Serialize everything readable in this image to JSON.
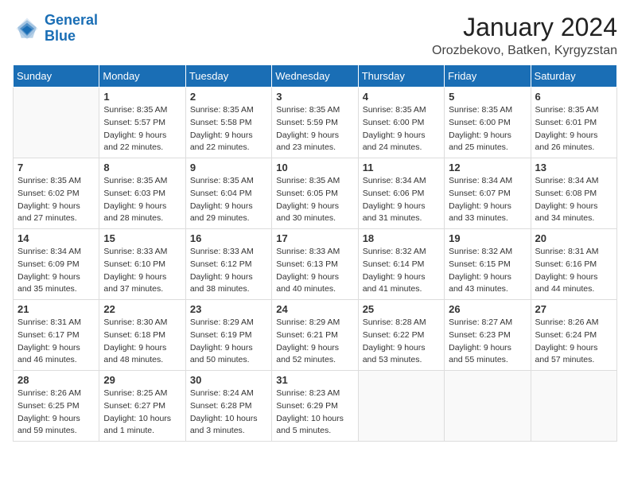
{
  "logo": {
    "line1": "General",
    "line2": "Blue"
  },
  "title": "January 2024",
  "location": "Orozbekovo, Batken, Kyrgyzstan",
  "weekdays": [
    "Sunday",
    "Monday",
    "Tuesday",
    "Wednesday",
    "Thursday",
    "Friday",
    "Saturday"
  ],
  "weeks": [
    [
      {
        "day": "",
        "sunrise": "",
        "sunset": "",
        "daylight": ""
      },
      {
        "day": "1",
        "sunrise": "Sunrise: 8:35 AM",
        "sunset": "Sunset: 5:57 PM",
        "daylight": "Daylight: 9 hours and 22 minutes."
      },
      {
        "day": "2",
        "sunrise": "Sunrise: 8:35 AM",
        "sunset": "Sunset: 5:58 PM",
        "daylight": "Daylight: 9 hours and 22 minutes."
      },
      {
        "day": "3",
        "sunrise": "Sunrise: 8:35 AM",
        "sunset": "Sunset: 5:59 PM",
        "daylight": "Daylight: 9 hours and 23 minutes."
      },
      {
        "day": "4",
        "sunrise": "Sunrise: 8:35 AM",
        "sunset": "Sunset: 6:00 PM",
        "daylight": "Daylight: 9 hours and 24 minutes."
      },
      {
        "day": "5",
        "sunrise": "Sunrise: 8:35 AM",
        "sunset": "Sunset: 6:00 PM",
        "daylight": "Daylight: 9 hours and 25 minutes."
      },
      {
        "day": "6",
        "sunrise": "Sunrise: 8:35 AM",
        "sunset": "Sunset: 6:01 PM",
        "daylight": "Daylight: 9 hours and 26 minutes."
      }
    ],
    [
      {
        "day": "7",
        "sunrise": "Sunrise: 8:35 AM",
        "sunset": "Sunset: 6:02 PM",
        "daylight": "Daylight: 9 hours and 27 minutes."
      },
      {
        "day": "8",
        "sunrise": "Sunrise: 8:35 AM",
        "sunset": "Sunset: 6:03 PM",
        "daylight": "Daylight: 9 hours and 28 minutes."
      },
      {
        "day": "9",
        "sunrise": "Sunrise: 8:35 AM",
        "sunset": "Sunset: 6:04 PM",
        "daylight": "Daylight: 9 hours and 29 minutes."
      },
      {
        "day": "10",
        "sunrise": "Sunrise: 8:35 AM",
        "sunset": "Sunset: 6:05 PM",
        "daylight": "Daylight: 9 hours and 30 minutes."
      },
      {
        "day": "11",
        "sunrise": "Sunrise: 8:34 AM",
        "sunset": "Sunset: 6:06 PM",
        "daylight": "Daylight: 9 hours and 31 minutes."
      },
      {
        "day": "12",
        "sunrise": "Sunrise: 8:34 AM",
        "sunset": "Sunset: 6:07 PM",
        "daylight": "Daylight: 9 hours and 33 minutes."
      },
      {
        "day": "13",
        "sunrise": "Sunrise: 8:34 AM",
        "sunset": "Sunset: 6:08 PM",
        "daylight": "Daylight: 9 hours and 34 minutes."
      }
    ],
    [
      {
        "day": "14",
        "sunrise": "Sunrise: 8:34 AM",
        "sunset": "Sunset: 6:09 PM",
        "daylight": "Daylight: 9 hours and 35 minutes."
      },
      {
        "day": "15",
        "sunrise": "Sunrise: 8:33 AM",
        "sunset": "Sunset: 6:10 PM",
        "daylight": "Daylight: 9 hours and 37 minutes."
      },
      {
        "day": "16",
        "sunrise": "Sunrise: 8:33 AM",
        "sunset": "Sunset: 6:12 PM",
        "daylight": "Daylight: 9 hours and 38 minutes."
      },
      {
        "day": "17",
        "sunrise": "Sunrise: 8:33 AM",
        "sunset": "Sunset: 6:13 PM",
        "daylight": "Daylight: 9 hours and 40 minutes."
      },
      {
        "day": "18",
        "sunrise": "Sunrise: 8:32 AM",
        "sunset": "Sunset: 6:14 PM",
        "daylight": "Daylight: 9 hours and 41 minutes."
      },
      {
        "day": "19",
        "sunrise": "Sunrise: 8:32 AM",
        "sunset": "Sunset: 6:15 PM",
        "daylight": "Daylight: 9 hours and 43 minutes."
      },
      {
        "day": "20",
        "sunrise": "Sunrise: 8:31 AM",
        "sunset": "Sunset: 6:16 PM",
        "daylight": "Daylight: 9 hours and 44 minutes."
      }
    ],
    [
      {
        "day": "21",
        "sunrise": "Sunrise: 8:31 AM",
        "sunset": "Sunset: 6:17 PM",
        "daylight": "Daylight: 9 hours and 46 minutes."
      },
      {
        "day": "22",
        "sunrise": "Sunrise: 8:30 AM",
        "sunset": "Sunset: 6:18 PM",
        "daylight": "Daylight: 9 hours and 48 minutes."
      },
      {
        "day": "23",
        "sunrise": "Sunrise: 8:29 AM",
        "sunset": "Sunset: 6:19 PM",
        "daylight": "Daylight: 9 hours and 50 minutes."
      },
      {
        "day": "24",
        "sunrise": "Sunrise: 8:29 AM",
        "sunset": "Sunset: 6:21 PM",
        "daylight": "Daylight: 9 hours and 52 minutes."
      },
      {
        "day": "25",
        "sunrise": "Sunrise: 8:28 AM",
        "sunset": "Sunset: 6:22 PM",
        "daylight": "Daylight: 9 hours and 53 minutes."
      },
      {
        "day": "26",
        "sunrise": "Sunrise: 8:27 AM",
        "sunset": "Sunset: 6:23 PM",
        "daylight": "Daylight: 9 hours and 55 minutes."
      },
      {
        "day": "27",
        "sunrise": "Sunrise: 8:26 AM",
        "sunset": "Sunset: 6:24 PM",
        "daylight": "Daylight: 9 hours and 57 minutes."
      }
    ],
    [
      {
        "day": "28",
        "sunrise": "Sunrise: 8:26 AM",
        "sunset": "Sunset: 6:25 PM",
        "daylight": "Daylight: 9 hours and 59 minutes."
      },
      {
        "day": "29",
        "sunrise": "Sunrise: 8:25 AM",
        "sunset": "Sunset: 6:27 PM",
        "daylight": "Daylight: 10 hours and 1 minute."
      },
      {
        "day": "30",
        "sunrise": "Sunrise: 8:24 AM",
        "sunset": "Sunset: 6:28 PM",
        "daylight": "Daylight: 10 hours and 3 minutes."
      },
      {
        "day": "31",
        "sunrise": "Sunrise: 8:23 AM",
        "sunset": "Sunset: 6:29 PM",
        "daylight": "Daylight: 10 hours and 5 minutes."
      },
      {
        "day": "",
        "sunrise": "",
        "sunset": "",
        "daylight": ""
      },
      {
        "day": "",
        "sunrise": "",
        "sunset": "",
        "daylight": ""
      },
      {
        "day": "",
        "sunrise": "",
        "sunset": "",
        "daylight": ""
      }
    ]
  ]
}
